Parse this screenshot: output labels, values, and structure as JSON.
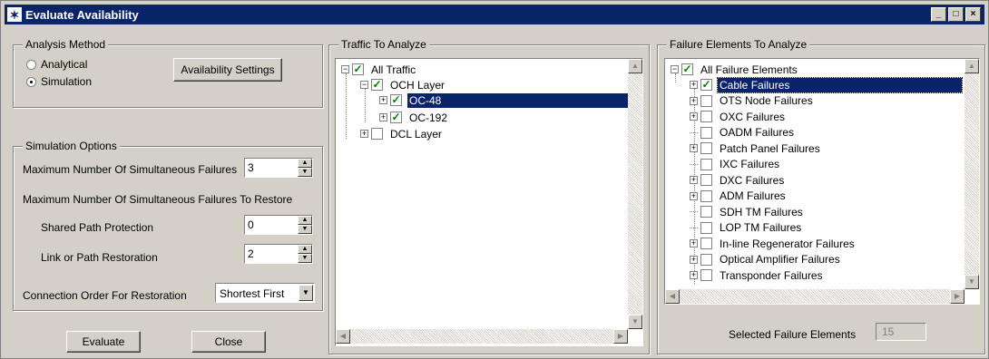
{
  "window": {
    "title": "Evaluate Availability",
    "buttons": [
      "_",
      "□",
      "×"
    ]
  },
  "analysis_method": {
    "legend": "Analysis Method",
    "options": [
      {
        "label": "Analytical",
        "selected": false
      },
      {
        "label": "Simulation",
        "selected": true
      }
    ],
    "settings_button": "Availability Settings"
  },
  "simulation_options": {
    "legend": "Simulation Options",
    "max_simultaneous_label": "Maximum Number Of Simultaneous Failures",
    "max_simultaneous_value": "3",
    "max_restore_label": "Maximum Number Of Simultaneous Failures To Restore",
    "shared_path_label": "Shared Path Protection",
    "shared_path_value": "0",
    "link_path_label": "Link or Path Restoration",
    "link_path_value": "2",
    "connection_order_label": "Connection Order For Restoration",
    "connection_order_value": "Shortest First"
  },
  "buttons": {
    "evaluate": "Evaluate",
    "close": "Close"
  },
  "traffic": {
    "legend": "Traffic To Analyze",
    "nodes": [
      "All Traffic",
      "OCH Layer",
      "OC-48",
      "OC-192",
      "DCL Layer"
    ]
  },
  "failure": {
    "legend": "Failure Elements To Analyze",
    "root": "All Failure Elements",
    "items": [
      "Cable Failures",
      "OTS Node Failures",
      "OXC Failures",
      "OADM Failures",
      "Patch Panel Failures",
      "IXC Failures",
      "DXC Failures",
      "ADM Failures",
      "SDH TM Failures",
      "LOP TM Failures",
      "In-line Regenerator Failures",
      "Optical Amplifier Failures",
      "Transponder Failures"
    ],
    "selected_label": "Selected Failure Elements",
    "selected_value": "15"
  }
}
